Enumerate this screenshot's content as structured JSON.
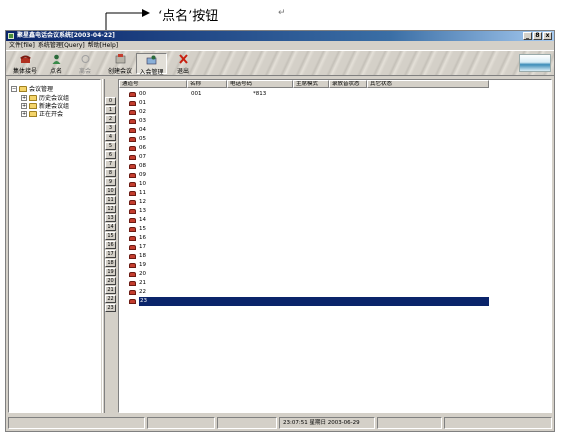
{
  "annotation": {
    "label": "‘点名’按钮",
    "mark": "↵"
  },
  "window": {
    "title": "聚星鑫电话会议系统[2003-04-22]",
    "controls": [
      "_",
      "8",
      "x"
    ]
  },
  "menu": [
    "文件[file]",
    "系统管理[Query]",
    "帮助[Help]"
  ],
  "toolbar": {
    "buttons": [
      {
        "label": "集体接号",
        "icon": "phone-icon",
        "state": "normal"
      },
      {
        "label": "点名",
        "icon": "person-icon",
        "state": "normal"
      },
      {
        "label": "离会",
        "icon": "leave-icon",
        "state": "disabled"
      },
      {
        "label": "创建会议",
        "icon": "create-meeting-icon",
        "state": "normal"
      },
      {
        "label": "入会管理",
        "icon": "join-manage-icon",
        "state": "pressed"
      },
      {
        "label": "退出",
        "icon": "exit-icon",
        "state": "normal"
      }
    ]
  },
  "tree": {
    "root": "会议管理",
    "children": [
      "历史会议组",
      "新建会议组",
      "正在开会"
    ]
  },
  "callbuttons": [
    "0",
    "1",
    "2",
    "3",
    "4",
    "5",
    "6",
    "7",
    "8",
    "9",
    "10",
    "11",
    "12",
    "13",
    "14",
    "15",
    "16",
    "17",
    "18",
    "19",
    "20",
    "21",
    "22",
    "23"
  ],
  "list": {
    "columns": [
      "通道号",
      "名称",
      "电话号码",
      "主席模式",
      "录放音状态",
      "其它状态"
    ],
    "rows": [
      {
        "channel": "00",
        "name": "001",
        "phone": "*813"
      },
      {
        "channel": "01",
        "name": "",
        "phone": ""
      },
      {
        "channel": "02",
        "name": "",
        "phone": ""
      },
      {
        "channel": "03",
        "name": "",
        "phone": ""
      },
      {
        "channel": "04",
        "name": "",
        "phone": ""
      },
      {
        "channel": "05",
        "name": "",
        "phone": ""
      },
      {
        "channel": "06",
        "name": "",
        "phone": ""
      },
      {
        "channel": "07",
        "name": "",
        "phone": ""
      },
      {
        "channel": "08",
        "name": "",
        "phone": ""
      },
      {
        "channel": "09",
        "name": "",
        "phone": ""
      },
      {
        "channel": "10",
        "name": "",
        "phone": ""
      },
      {
        "channel": "11",
        "name": "",
        "phone": ""
      },
      {
        "channel": "12",
        "name": "",
        "phone": ""
      },
      {
        "channel": "13",
        "name": "",
        "phone": ""
      },
      {
        "channel": "14",
        "name": "",
        "phone": ""
      },
      {
        "channel": "15",
        "name": "",
        "phone": ""
      },
      {
        "channel": "16",
        "name": "",
        "phone": ""
      },
      {
        "channel": "17",
        "name": "",
        "phone": ""
      },
      {
        "channel": "18",
        "name": "",
        "phone": ""
      },
      {
        "channel": "19",
        "name": "",
        "phone": ""
      },
      {
        "channel": "20",
        "name": "",
        "phone": ""
      },
      {
        "channel": "21",
        "name": "",
        "phone": ""
      },
      {
        "channel": "22",
        "name": "",
        "phone": ""
      },
      {
        "channel": "23",
        "name": "",
        "phone": "",
        "selected": true
      }
    ]
  },
  "status": {
    "cells": [
      "",
      "",
      "",
      "23:07:51 星期日 2003-06-29",
      "",
      ""
    ]
  },
  "colors": {
    "selection": "#0a246a",
    "titlebar": "#0a246a",
    "chrome": "#d4d0c8"
  }
}
